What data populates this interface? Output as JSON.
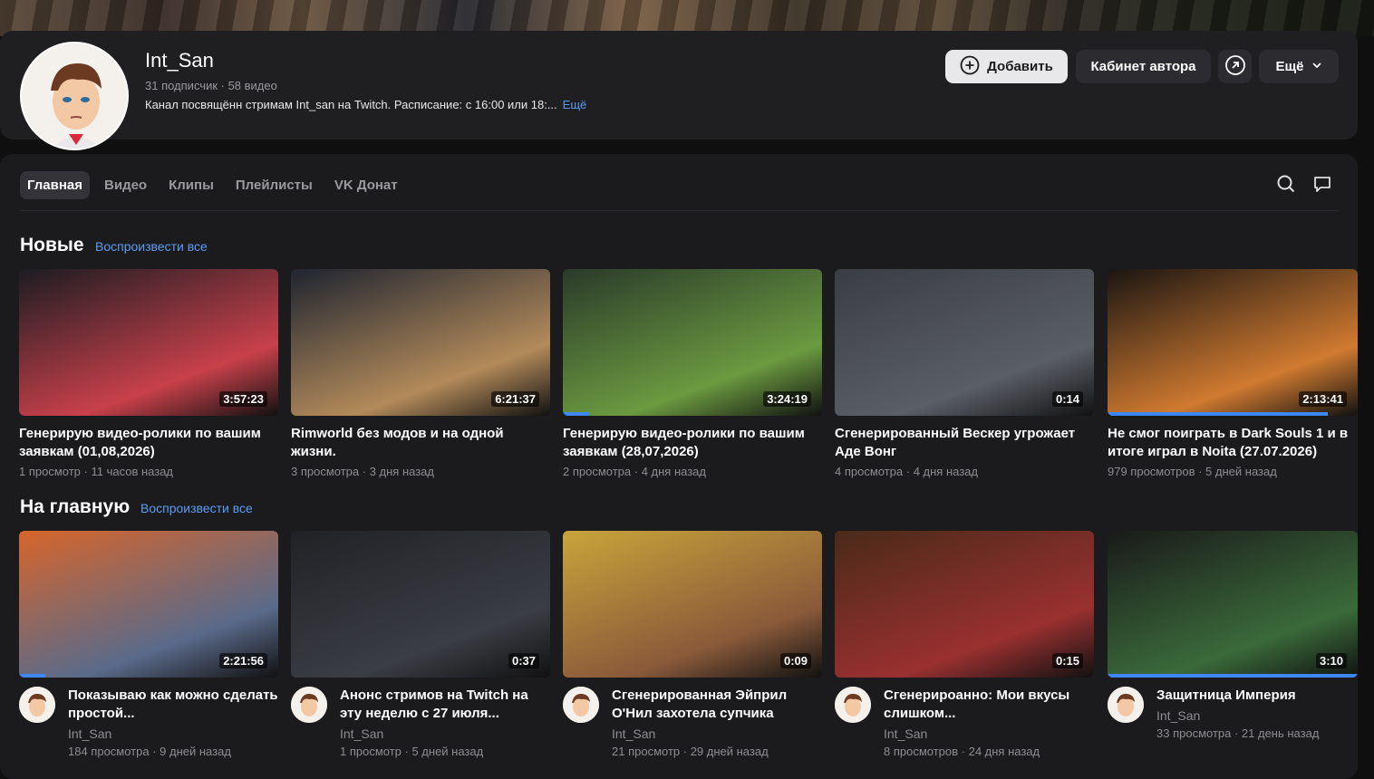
{
  "channel": {
    "name": "Int_San",
    "stats": "31 подписчик · 58 видео",
    "description": "Канал посвящённ стримам Int_san на Twitch. Расписание: с 16:00 или 18:...",
    "description_more": "Ещё"
  },
  "header_buttons": {
    "add": "Добавить",
    "studio": "Кабинет автора",
    "more": "Ещё"
  },
  "tabs": [
    {
      "label": "Главная",
      "active": true
    },
    {
      "label": "Видео",
      "active": false
    },
    {
      "label": "Клипы",
      "active": false
    },
    {
      "label": "Плейлисты",
      "active": false
    },
    {
      "label": "VK Донат",
      "active": false
    }
  ],
  "sections": [
    {
      "title": "Новые",
      "play_all": "Воспроизвести все",
      "videos": [
        {
          "title": "Генерирую видео-ролики по вашим заявкам (01,08,2026)",
          "meta": "1 просмотр · 11 часов назад",
          "duration": "3:57:23",
          "progress": 0,
          "thumb": "#1c1c22",
          "accent": "#c8404a"
        },
        {
          "title": "Rimworld без модов и на одной жизни.",
          "meta": "3 просмотра · 3 дня назад",
          "duration": "6:21:37",
          "progress": 0,
          "thumb": "#1e2430",
          "accent": "#b38a5a"
        },
        {
          "title": "Генерирую видео-ролики по вашим заявкам (28,07,2026)",
          "meta": "2 просмотра · 4 дня назад",
          "duration": "3:24:19",
          "progress": 0.1,
          "thumb": "#2a3a2a",
          "accent": "#6b9a40"
        },
        {
          "title": "Сгенерированный Вескер угрожает Аде Вонг",
          "meta": "4 просмотра · 4 дня назад",
          "duration": "0:14",
          "progress": 0,
          "thumb": "#3a3d44",
          "accent": "#5a5e66"
        },
        {
          "title": "Не смог поиграть в Dark Souls 1 и в итоге играл в Noita (27.07.2026)",
          "meta": "979 просмотров · 5 дней назад",
          "duration": "2:13:41",
          "progress": 0.88,
          "thumb": "#1a1512",
          "accent": "#d07a30"
        }
      ]
    },
    {
      "title": "На главную",
      "play_all": "Воспроизвести все",
      "videos": [
        {
          "title": "Показываю как можно сделать простой...",
          "channel": "Int_San",
          "meta": "184 просмотра · 9 дней назад",
          "duration": "2:21:56",
          "progress": 0.1,
          "thumb": "#d8652a",
          "accent": "#5a6a8a"
        },
        {
          "title": "Анонс стримов на Twitch на эту неделю с 27 июля...",
          "channel": "Int_San",
          "meta": "1 просмотр · 5 дней назад",
          "duration": "0:37",
          "progress": 0,
          "thumb": "#202226",
          "accent": "#3a3d44"
        },
        {
          "title": "Сгенерированная Эйприл О'Нил захотела супчика",
          "channel": "Int_San",
          "meta": "21 просмотр · 29 дней назад",
          "duration": "0:09",
          "progress": 0,
          "thumb": "#c9a43a",
          "accent": "#8a5a3a"
        },
        {
          "title": "Сгенерироанно: Мои вкусы слишком...",
          "channel": "Int_San",
          "meta": "8 просмотров · 24 дня назад",
          "duration": "0:15",
          "progress": 0,
          "thumb": "#4a2a18",
          "accent": "#9a3030"
        },
        {
          "title": "Защитница Империя",
          "channel": "Int_San",
          "meta": "33 просмотра · 21 день назад",
          "duration": "3:10",
          "progress": 1.0,
          "thumb": "#1a1a1a",
          "accent": "#3a6a3a"
        }
      ]
    }
  ],
  "icons": {
    "add": "plus-circle-icon",
    "share": "arrow-up-right-circle-icon",
    "more_chevron": "chevron-down-icon",
    "search": "search-icon",
    "comments": "chat-bubble-icon"
  }
}
